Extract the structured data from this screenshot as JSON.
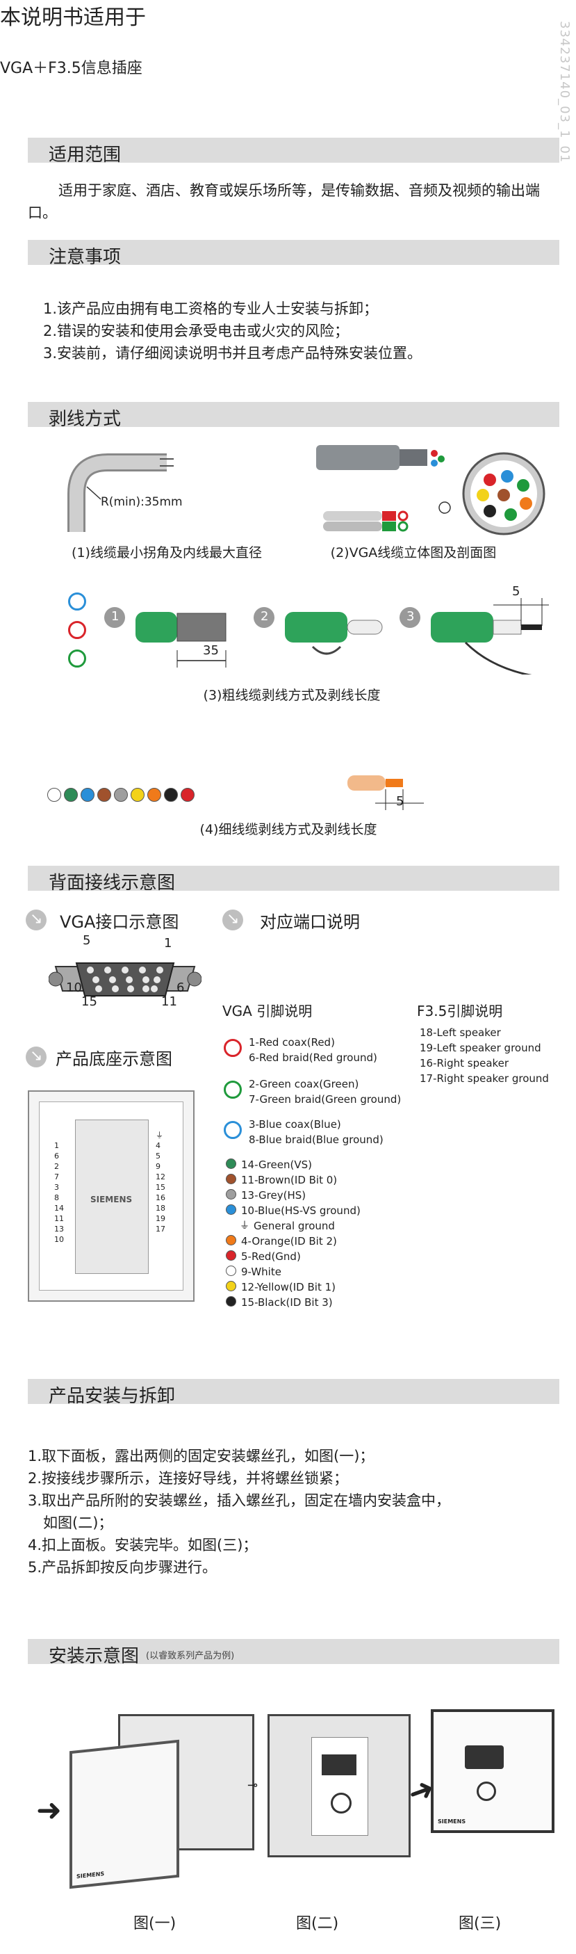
{
  "header": {
    "title": "本说明书适用于",
    "product": "VGA＋F3.5信息插座",
    "code": "334237140_03_1_01"
  },
  "scope": {
    "heading": "适用范围",
    "text": "适用于家庭、酒店、教育或娱乐场所等，是传输数据、音频及视频的输出端口。"
  },
  "notes": {
    "heading": "注意事项",
    "items": [
      "1.该产品应由拥有电工资格的专业人士安装与拆卸；",
      "2.错误的安装和使用会承受电击或火灾的风险；",
      "3.安装前，请仔细阅读说明书并且考虑产品特殊安装位置。"
    ]
  },
  "stripping": {
    "heading": "剥线方式",
    "bend_label": "R(min):35mm",
    "caption1": "(1)线缆最小拐角及内线最大直径",
    "caption2": "(2)VGA线缆立体图及剖面图",
    "steps": [
      "1",
      "2",
      "3"
    ],
    "dim35": "35",
    "dim5a": "5",
    "caption3": "(3)粗线缆剥线方式及剥线长度",
    "dim5b": "5",
    "caption4": "(4)细线缆剥线方式及剥线长度"
  },
  "wiring": {
    "heading": "背面接线示意图",
    "vga_title": "VGA接口示意图",
    "port_title": "对应端口说明",
    "base_title": "产品底座示意图",
    "vga_pin_labels": {
      "p5": "5",
      "p1": "1",
      "p10": "10",
      "p6": "6",
      "p15": "15",
      "p11": "11"
    },
    "vga_col_title": "VGA 引脚说明",
    "f35_col_title": "F3.5引脚说明",
    "coax": [
      {
        "a": "1-Red coax(Red)",
        "b": "6-Red braid(Red ground)",
        "color": "#d9242a"
      },
      {
        "a": "2-Green coax(Green)",
        "b": "7-Green braid(Green ground)",
        "color": "#1f9a3c"
      },
      {
        "a": "3-Blue coax(Blue)",
        "b": "8-Blue braid(Blue ground)",
        "color": "#2a8fd8"
      }
    ],
    "singles": [
      {
        "label": "14-Green(VS)",
        "color": "#2e8b57"
      },
      {
        "label": "11-Brown(ID Bit 0)",
        "color": "#a0522d"
      },
      {
        "label": "13-Grey(HS)",
        "color": "#9e9e9e"
      },
      {
        "label": "10-Blue(HS-VS ground)",
        "color": "#2a8fd8"
      },
      {
        "label": "General ground",
        "color": ""
      },
      {
        "label": "4-Orange(ID Bit 2)",
        "color": "#f07a1a"
      },
      {
        "label": "5-Red(Gnd)",
        "color": "#d9242a"
      },
      {
        "label": "9-White",
        "color": "#ffffff"
      },
      {
        "label": "12-Yellow(ID Bit 1)",
        "color": "#f2d21a"
      },
      {
        "label": "15-Black(ID Bit 3)",
        "color": "#222222"
      }
    ],
    "f35": [
      "18-Left speaker",
      "19-Left speaker ground",
      "16-Right speaker",
      "17-Right speaker ground"
    ],
    "base_brand": "SIEMENS",
    "base_left_nums": [
      "1",
      "6",
      "2",
      "7",
      "3",
      "8",
      "14",
      "11",
      "13",
      "10"
    ],
    "base_right_nums": [
      "4",
      "5",
      "9",
      "12",
      "15",
      "16",
      "18",
      "19",
      "17"
    ],
    "base_ground": "⏚"
  },
  "install": {
    "heading": "产品安装与拆卸",
    "items": [
      "1.取下面板，露出两侧的固定安装螺丝孔，如图(一)；",
      "2.按接线步骤所示，连接好导线，并将螺丝锁紧；",
      "3.取出产品所附的安装螺丝，插入螺丝孔，固定在墙内安装盒中，",
      "如图(二)；",
      "4.扣上面板。安装完毕。如图(三)；",
      "5.产品拆卸按反向步骤进行。"
    ]
  },
  "diagram": {
    "heading": "安装示意图",
    "note": "(以睿致系列产品为例)",
    "fig1": "图(一)",
    "fig2": "图(二)",
    "fig3": "图(三)",
    "brand": "SIEMENS"
  }
}
